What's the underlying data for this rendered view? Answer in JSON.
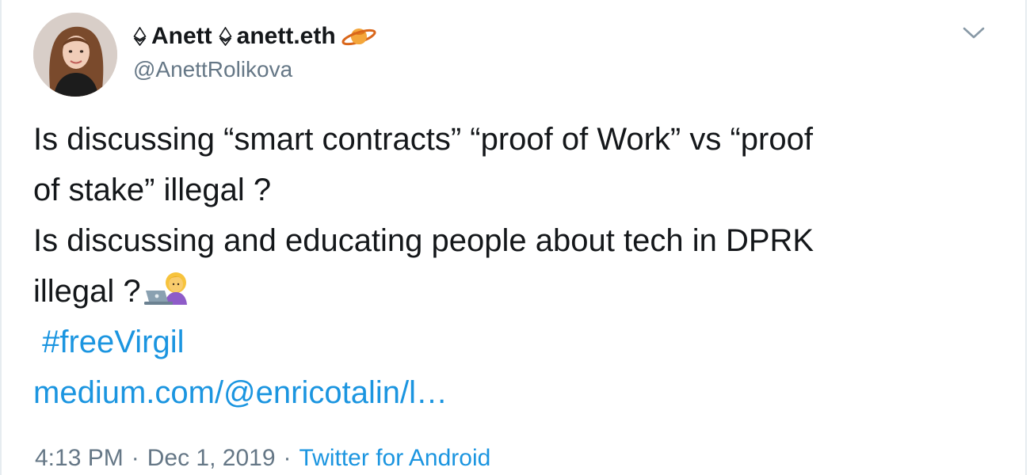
{
  "author": {
    "display_name_part1": "Anett",
    "display_name_part2": "anett.eth",
    "handle": "@AnettRolikova",
    "avatar_icon": "profile-photo",
    "name_icons": [
      "ethereum-icon",
      "ethereum-icon",
      "ringed-planet-icon"
    ]
  },
  "tweet": {
    "line1": "Is discussing “smart contracts” “proof of Work” vs “proof",
    "line2": "of stake”  illegal ?",
    "line3": "Is discussing and educating people about tech in DPRK",
    "line4": "illegal ?",
    "line4_emoji": "woman-technologist-emoji",
    "hashtag": "#freeVirgil",
    "url": "medium.com/@enricotalin/l…"
  },
  "meta": {
    "time": "4:13 PM",
    "date": "Dec 1, 2019",
    "separator": "·",
    "source": "Twitter for Android"
  },
  "colors": {
    "text": "#14171a",
    "secondary": "#657786",
    "link": "#1b95e0",
    "border": "#e6ecf0"
  }
}
